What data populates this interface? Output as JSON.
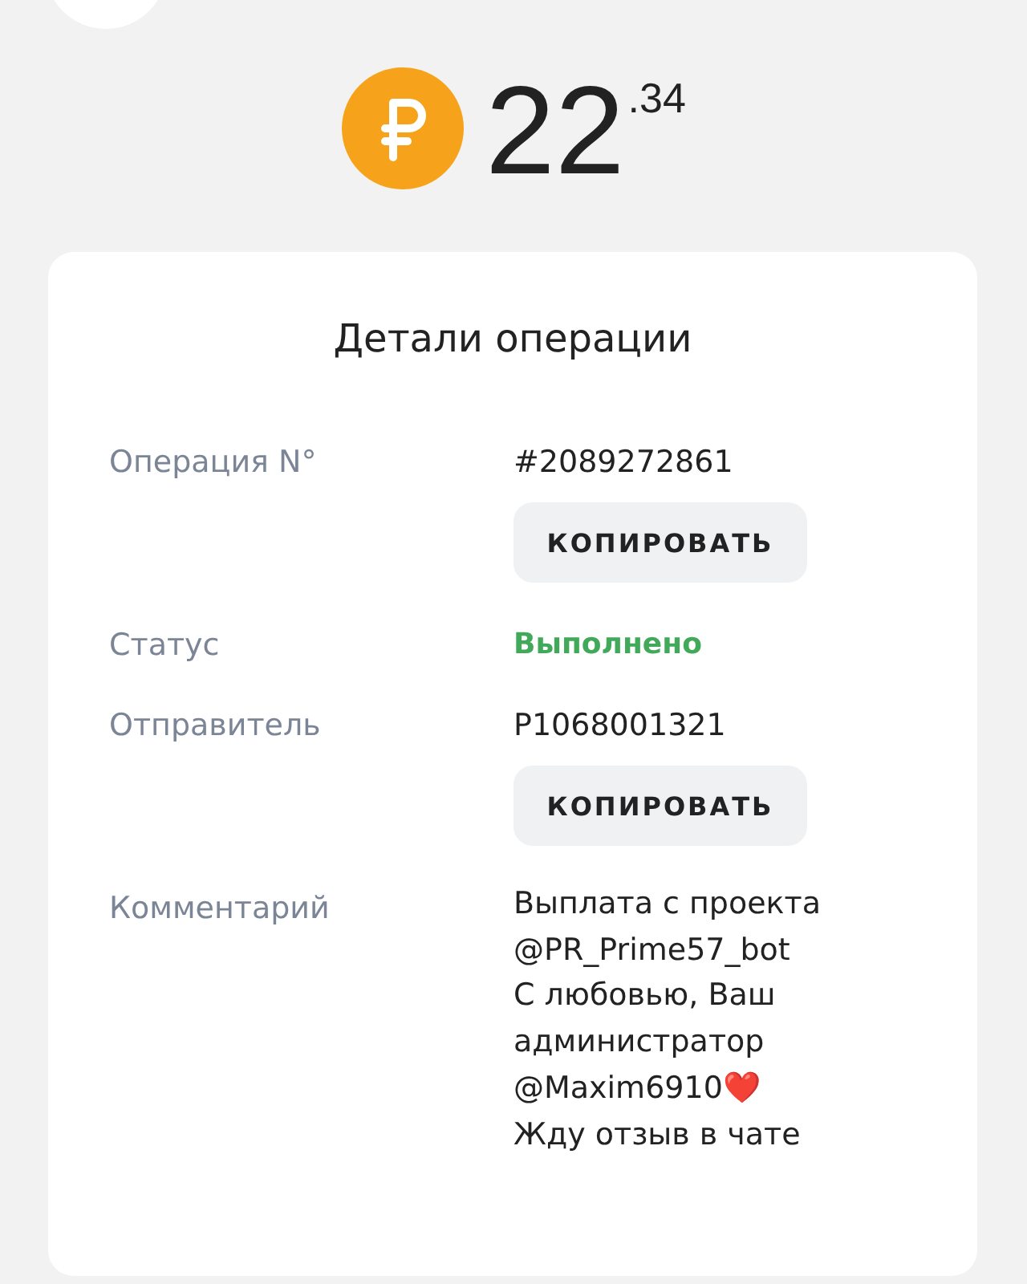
{
  "amount": {
    "integer": "22",
    "fraction": ".34"
  },
  "card": {
    "title": "Детали операции",
    "rows": [
      {
        "kind": "copyable",
        "label": "Операция N°",
        "value": "#2089272861",
        "button": "КОПИРОВАТЬ"
      },
      {
        "kind": "status",
        "label": "Статус",
        "value": "Выполнено"
      },
      {
        "kind": "copyable",
        "label": "Отправитель",
        "value": "P1068001321",
        "button": "КОПИРОВАТЬ"
      },
      {
        "kind": "multiline",
        "label": "Комментарий",
        "lines": [
          "Выплата с проекта",
          "@PR_Prime57_bot",
          "С любовью, Ваш",
          "администратор",
          "@Maxim6910❤️",
          "Жду отзыв в чате"
        ]
      }
    ]
  }
}
